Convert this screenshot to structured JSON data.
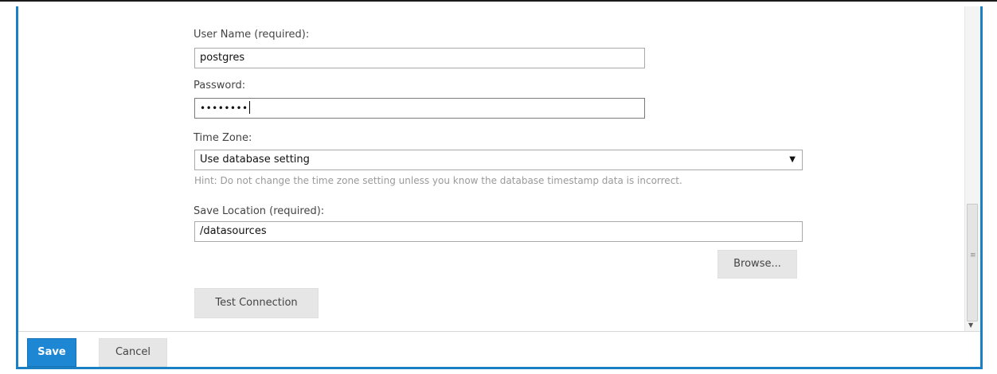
{
  "form": {
    "username": {
      "label": "User Name (required):",
      "value": "postgres"
    },
    "password": {
      "label": "Password:",
      "masked_value": "••••••••"
    },
    "timezone": {
      "label": "Time Zone:",
      "selected": "Use database setting"
    },
    "hint": "Hint: Do not change the time zone setting unless you know the database timestamp data is incorrect.",
    "save_location": {
      "label": "Save Location (required):",
      "value": "/datasources"
    },
    "browse_label": "Browse...",
    "test_connection_label": "Test Connection"
  },
  "footer": {
    "save_label": "Save",
    "cancel_label": "Cancel"
  },
  "colors": {
    "accent": "#1b7fc4",
    "primary_button": "#1d87d4",
    "secondary_button": "#e6e6e6"
  },
  "icons": {
    "dropdown": "chevron-down-icon",
    "scroll_down": "arrow-down-icon",
    "scroll_grip": "grip-icon"
  }
}
